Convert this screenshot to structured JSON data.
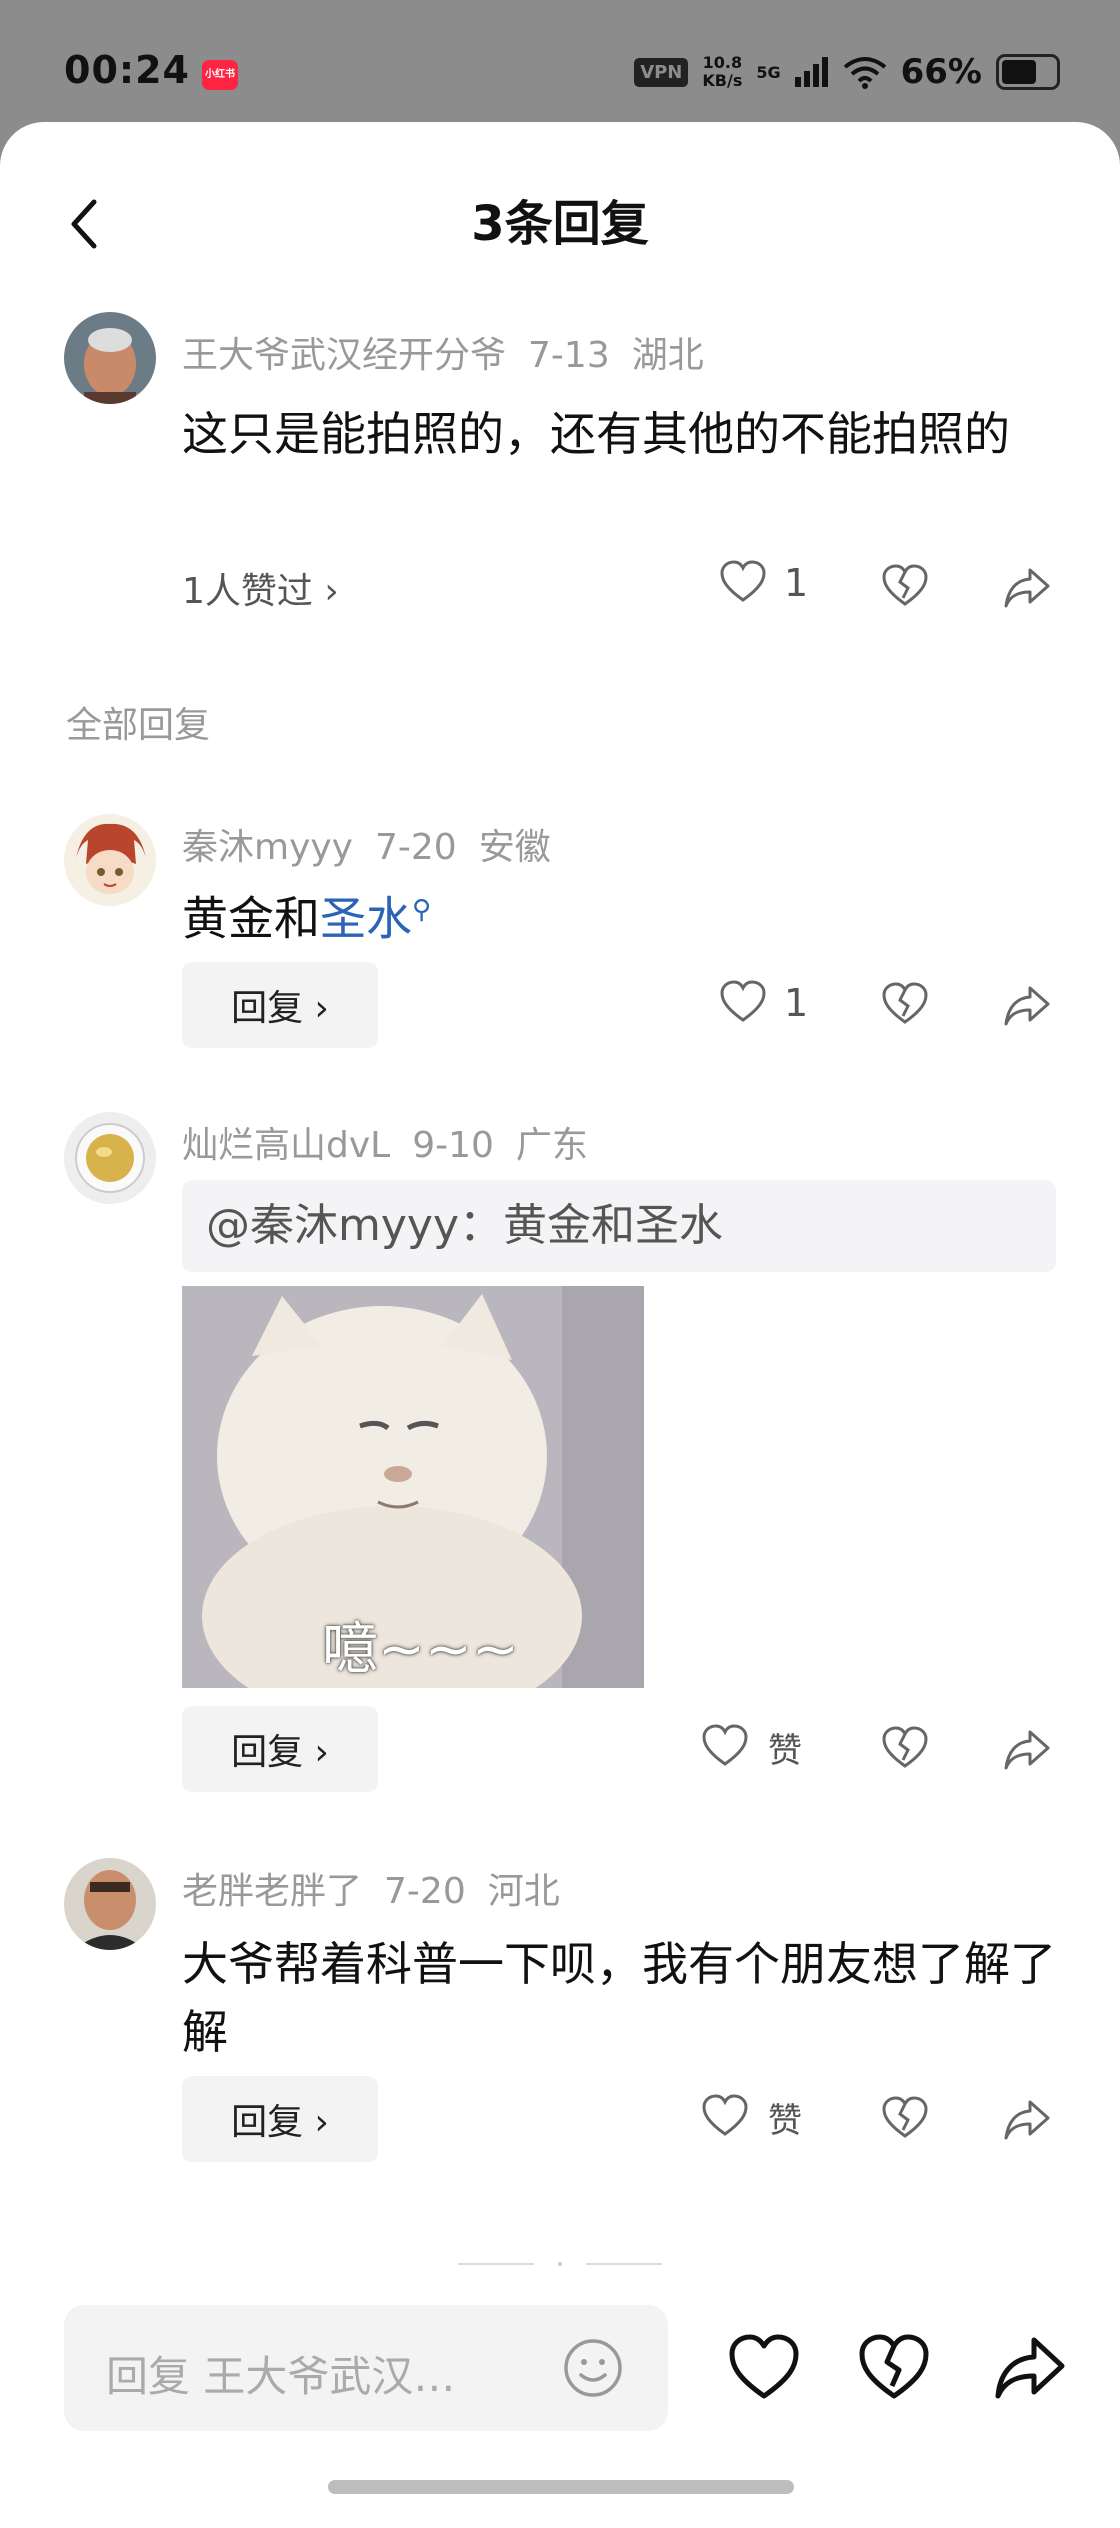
{
  "status_bar": {
    "time": "00:24",
    "app_badge": "小红书",
    "vpn": "VPN",
    "net_speed_value": "10.8",
    "net_speed_unit": "KB/s",
    "network": "5G",
    "battery": "66%",
    "battery_level": 0.66
  },
  "header": {
    "title": "3条回复",
    "back_icon": "chevron-left-icon"
  },
  "main_comment": {
    "author": "王大爷武汉经开分爷",
    "date": "7-13",
    "location": "湖北",
    "text": "这只是能拍照的，还有其他的不能拍照的",
    "likes_summary": "1人赞过 ›",
    "like_count": "1"
  },
  "section_label": "全部回复",
  "replies": [
    {
      "author": "秦沐myyy",
      "date": "7-20",
      "location": "安徽",
      "text_prefix": "黄金和",
      "text_link": "圣水",
      "like_count": "1",
      "reply_label": "回复 ›"
    },
    {
      "author": "灿烂高山dvL",
      "date": "9-10",
      "location": "广东",
      "quote": "@秦沐myyy：黄金和圣水",
      "image_caption": "噫~~~",
      "like_label": "赞",
      "reply_label": "回复 ›"
    },
    {
      "author": "老胖老胖了",
      "date": "7-20",
      "location": "河北",
      "text": "大爷帮着科普一下呗，我有个朋友想了解了解",
      "like_label": "赞",
      "reply_label": "回复 ›"
    }
  ],
  "input": {
    "placeholder": "回复 王大爷武汉…"
  },
  "colors": {
    "link": "#2b63b6",
    "badge": "#ff2442",
    "meta": "#999999"
  }
}
